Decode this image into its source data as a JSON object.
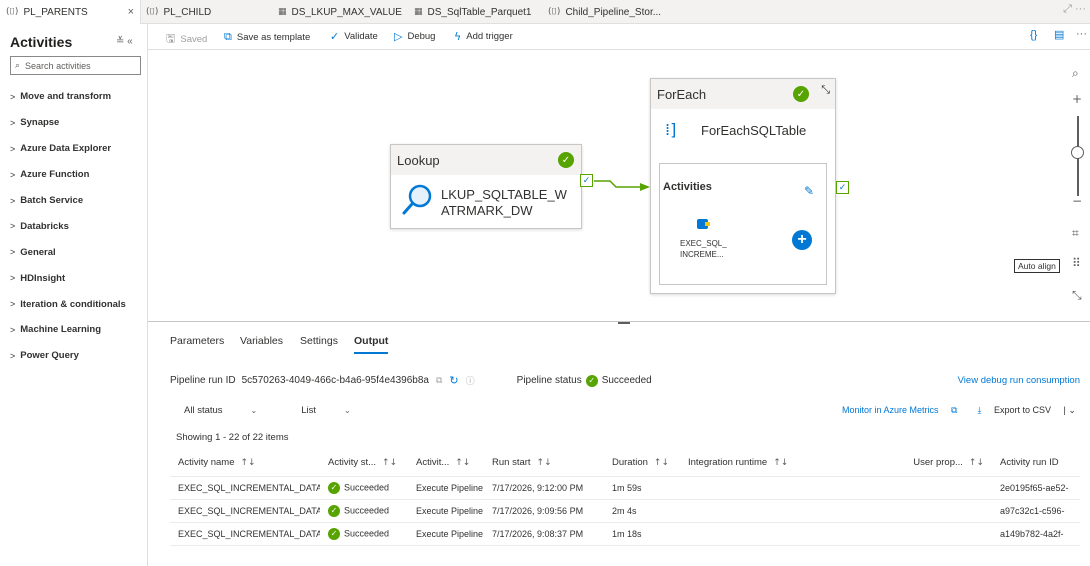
{
  "tabs": [
    {
      "label": "PL_PARENTS",
      "icon": "pipeline-icon",
      "active": true,
      "close": "×"
    },
    {
      "label": "PL_CHILD",
      "icon": "pipeline-icon"
    },
    {
      "label": "DS_LKUP_MAX_VALUE",
      "icon": "table-icon"
    },
    {
      "label": "DS_SqlTable_Parquet1",
      "icon": "table-icon"
    },
    {
      "label": "Child_Pipeline_Stor...",
      "icon": "pipeline-icon"
    }
  ],
  "activities_pane": {
    "title": "Activities",
    "search_placeholder": "Search activities",
    "categories": [
      "Move and transform",
      "Synapse",
      "Azure Data Explorer",
      "Azure Function",
      "Batch Service",
      "Databricks",
      "General",
      "HDInsight",
      "Iteration & conditionals",
      "Machine Learning",
      "Power Query"
    ]
  },
  "toolbar": {
    "saved": "Saved",
    "save_template": "Save as template",
    "validate": "Validate",
    "debug": "Debug",
    "add_trigger": "Add trigger"
  },
  "canvas": {
    "lookup": {
      "header": "Lookup",
      "name_line1": "LKUP_SQLTABLE_W",
      "name_line2": "ATRMARK_DW"
    },
    "foreach": {
      "header": "ForEach",
      "name": "ForEachSQLTable",
      "inner_title": "Activities",
      "inner_activity_line1": "EXEC_SQL_",
      "inner_activity_line2": "INCREME..."
    },
    "tooltip": "Auto align"
  },
  "output": {
    "tabs": [
      "Parameters",
      "Variables",
      "Settings",
      "Output"
    ],
    "active_tab": "Output",
    "run_id_label": "Pipeline run ID",
    "run_id": "5c570263-4049-466c-b4a6-95f4e4396b8a",
    "status_label": "Pipeline status",
    "status": "Succeeded",
    "debug_link": "View debug run consumption",
    "filter_status": "All status",
    "filter_view": "List",
    "monitor_link": "Monitor in Azure Metrics",
    "export": "Export to CSV",
    "showing": "Showing 1 - 22 of 22 items",
    "columns": [
      "Activity name",
      "Activity st...",
      "Activit...",
      "Run start",
      "Duration",
      "Integration runtime",
      "User prop...",
      "Activity run ID"
    ],
    "rows": [
      {
        "name": "EXEC_SQL_INCREMENTAL_DATA",
        "status": "Succeeded",
        "type": "Execute Pipeline",
        "start": "7/17/2026, 9:12:00 PM",
        "duration": "1m 59s",
        "runtime": "",
        "user": "",
        "run_id": "2e0195f65-ae52-"
      },
      {
        "name": "EXEC_SQL_INCREMENTAL_DATA",
        "status": "Succeeded",
        "type": "Execute Pipeline",
        "start": "7/17/2026, 9:09:56 PM",
        "duration": "2m 4s",
        "runtime": "",
        "user": "",
        "run_id": "a97c32c1-c596-"
      },
      {
        "name": "EXEC_SQL_INCREMENTAL_DATA",
        "status": "Succeeded",
        "type": "Execute Pipeline",
        "start": "7/17/2026, 9:08:37 PM",
        "duration": "1m 18s",
        "runtime": "",
        "user": "",
        "run_id": "a149b782-4a2f-"
      }
    ]
  }
}
